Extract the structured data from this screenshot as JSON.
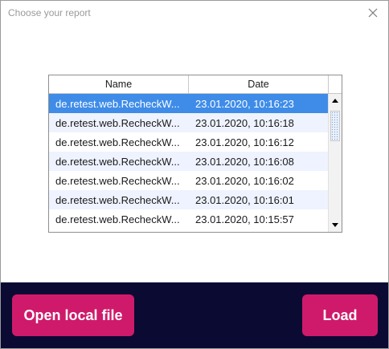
{
  "window": {
    "title": "Choose your report"
  },
  "table": {
    "columns": [
      "Name",
      "Date"
    ],
    "rows": [
      {
        "name": "de.retest.web.RecheckW...",
        "date": "23.01.2020, 10:16:23",
        "selected": true
      },
      {
        "name": "de.retest.web.RecheckW...",
        "date": "23.01.2020, 10:16:18",
        "selected": false
      },
      {
        "name": "de.retest.web.RecheckW...",
        "date": "23.01.2020, 10:16:12",
        "selected": false
      },
      {
        "name": "de.retest.web.RecheckW...",
        "date": "23.01.2020, 10:16:08",
        "selected": false
      },
      {
        "name": "de.retest.web.RecheckW...",
        "date": "23.01.2020, 10:16:02",
        "selected": false
      },
      {
        "name": "de.retest.web.RecheckW...",
        "date": "23.01.2020, 10:16:01",
        "selected": false
      },
      {
        "name": "de.retest.web.RecheckW...",
        "date": "23.01.2020, 10:15:57",
        "selected": false
      }
    ]
  },
  "buttons": {
    "open_local_file": "Open local file",
    "load": "Load"
  },
  "colors": {
    "footer_bg": "#0b0a33",
    "button_bg": "#cf1a6b",
    "selected_row": "#3f8ce8",
    "alt_row": "#eef3ff"
  },
  "icons": {
    "close": "close-icon",
    "scroll_up": "arrow-up-icon",
    "scroll_down": "arrow-down-icon"
  }
}
